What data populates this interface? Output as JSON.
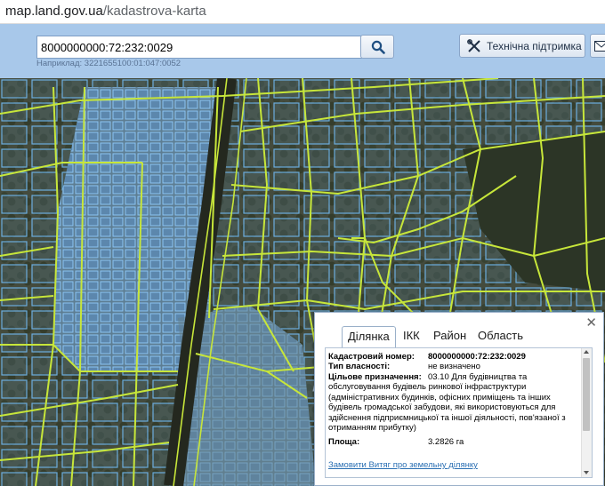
{
  "browser": {
    "url_host": "map.land.gov.ua",
    "url_path": "/kadastrova-karta"
  },
  "header": {
    "search_value": "8000000000:72:232:0029",
    "search_hint": "Наприклад: 3221655100:01:047:0052",
    "support_label": "Технічна підтримка"
  },
  "popup": {
    "tabs": [
      "Ділянка",
      "ІКК",
      "Район",
      "Область"
    ],
    "active_tab": "Ділянка",
    "cadastral_label": "Кадастровий номер:",
    "cadastral_value": "8000000000:72:232:0029",
    "ownership_label": "Тип власності:",
    "ownership_value": "не визначено",
    "purpose_label": "Цільове призначення:",
    "purpose_value": "03.10 Для будівництва та",
    "purpose_desc": "обслуговування будівель ринкової інфраструктури (адміністративних будинків, офісних приміщень та інших будівель громадської забудови, які використовуються для здійснення підприємницької та іншої діяльності, пов'язаної з отриманням прибутку)",
    "area_label": "Площа:",
    "area_value": "3.2826 га",
    "order_link": "Замовити Витяг про земельну ділянку"
  },
  "colors": {
    "header_bg": "#a8c8ea",
    "parcel_outline": "#66b3f0",
    "boundary_line": "#c7e63a",
    "link": "#2a6fb3"
  }
}
